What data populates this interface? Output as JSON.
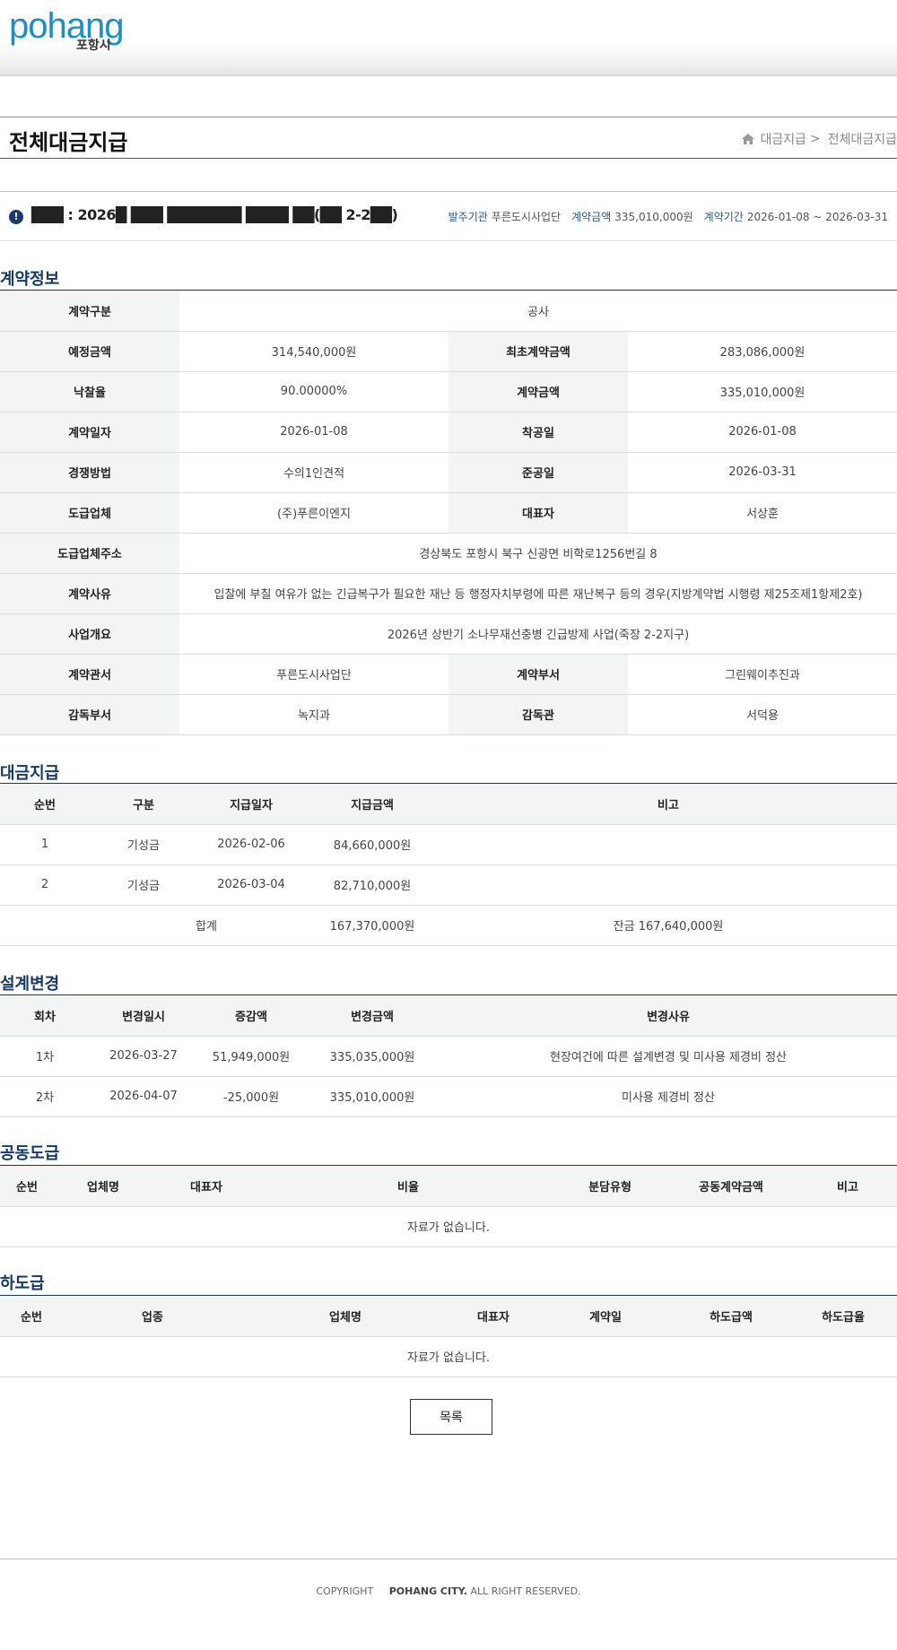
{
  "header": {
    "logo_text": "pohang",
    "logo_sub": "포항시"
  },
  "page": {
    "title": "전체대금지급",
    "breadcrumb": [
      "대금지급",
      "전체대금지급"
    ],
    "breadcrumb_sep": ">"
  },
  "contract": {
    "name": "███ : 2026█ ███ ███████ ████ ██(██ 2-2██)",
    "meta": [
      {
        "label": "발주기관",
        "value": "푸른도시사업단"
      },
      {
        "label": "계약금액",
        "value": "335,010,000원"
      },
      {
        "label": "계약기간",
        "value": "2026-01-08 ~ 2026-03-31"
      }
    ]
  },
  "contract_info": {
    "title": "계약정보",
    "rows": [
      [
        "계약구분",
        "공사"
      ],
      [
        "예정금액",
        "314,540,000원",
        "최초계약금액",
        "283,086,000원"
      ],
      [
        "낙찰율",
        "90.00000%",
        "계약금액",
        "335,010,000원"
      ],
      [
        "계약일자",
        "2026-01-08",
        "착공일",
        "2026-01-08"
      ],
      [
        "경쟁방법",
        "수의1인견적",
        "준공일",
        "2026-03-31"
      ],
      [
        "도급업체",
        "(주)푸른이엔지",
        "대표자",
        "서상훈"
      ],
      [
        "도급업체주소",
        "경상북도 포항시 북구 신광면 비학로1256번길 8"
      ],
      [
        "계약사유",
        "입찰에 부칠 여유가 없는 긴급복구가 필요한 재난 등 행정자치부령에 따른 재난복구 등의 경우(지방계약법 시행령 제25조제1항제2호)"
      ],
      [
        "사업개요",
        "2026년 상반기 소나무재선충병 긴급방제 사업(죽장 2-2지구)"
      ],
      [
        "계약관서",
        "푸른도시사업단",
        "계약부서",
        "그린웨이추진과"
      ],
      [
        "감독부서",
        "녹지과",
        "감독관",
        "서덕용"
      ]
    ]
  },
  "payments": {
    "title": "대금지급",
    "headers": [
      "순번",
      "구분",
      "지급일자",
      "지급금액",
      "비고"
    ],
    "rows": [
      [
        "1",
        "기성금",
        "2026-02-06",
        "84,660,000원",
        ""
      ],
      [
        "2",
        "기성금",
        "2026-03-04",
        "82,710,000원",
        ""
      ]
    ],
    "total": {
      "label": "합계",
      "amount": "167,370,000원",
      "balance": "잔금 167,640,000원"
    }
  },
  "design_changes": {
    "title": "설계변경",
    "headers": [
      "회차",
      "변경일시",
      "증감액",
      "변경금액",
      "변경사유"
    ],
    "rows": [
      [
        "1차",
        "2026-03-27",
        "51,949,000원",
        "335,035,000원",
        "현장여건에 따른 설계변경 및 미사용 제경비 정산"
      ],
      [
        "2차",
        "2026-04-07",
        "-25,000원",
        "335,010,000원",
        "미사용 제경비 정산"
      ]
    ]
  },
  "joint_contract": {
    "title": "공동도급",
    "headers": [
      "순번",
      "업체명",
      "대표자",
      "비율",
      "분담유형",
      "공동계약금액",
      "비고"
    ],
    "empty": "자료가 없습니다."
  },
  "subcontract": {
    "title": "하도급",
    "headers": [
      "순번",
      "업종",
      "업체명",
      "대표자",
      "계약일",
      "하도급액",
      "하도급율"
    ],
    "empty": "자료가 없습니다."
  },
  "actions": {
    "list_label": "목록"
  },
  "footer": {
    "copyright": "COPYRIGHT",
    "owner": "POHANG CITY.",
    "rights": "ALL RIGHT RESERVED."
  },
  "colors": {
    "accent": "#173a63",
    "header_bg": "#f3f5f4",
    "logo": "#1e8fc4"
  }
}
